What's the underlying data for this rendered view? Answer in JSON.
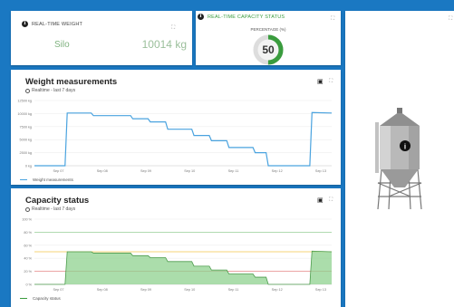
{
  "weight_card": {
    "title": "REAL-TIME WEIGHT",
    "location": "Silo",
    "value": "10014 kg"
  },
  "capacity_card": {
    "title": "REAL-TIME CAPACITY STATUS",
    "subtitle": "PERCENTAGE (%)",
    "value": "50",
    "percent": 50,
    "accent": "#3a9c3e"
  },
  "weight_chart": {
    "title": "Weight measurements",
    "subtitle": "Realtime - last 7 days",
    "legend": "Weight measurements",
    "line_color": "#4aa3df"
  },
  "capacity_chart": {
    "title": "Capacity status",
    "subtitle": "Realtime - last 7 days",
    "legend": "Capacity status",
    "fill_color": "#8fd18f"
  },
  "chart_data": [
    {
      "type": "line",
      "x": [
        "Sep 07",
        "Sep 08",
        "Sep 09",
        "Sep 10",
        "Sep 11",
        "Sep 12",
        "Sep 13"
      ],
      "y_ticks": [
        "0 kg",
        "2500 kg",
        "5000 kg",
        "7500 kg",
        "10000 kg",
        "12500 kg"
      ],
      "ylim": [
        0,
        12500
      ],
      "series": [
        {
          "name": "Weight measurements",
          "points": [
            [
              0.0,
              0
            ],
            [
              0.7,
              0
            ],
            [
              0.75,
              10100
            ],
            [
              1.3,
              10100
            ],
            [
              1.35,
              9600
            ],
            [
              2.2,
              9600
            ],
            [
              2.25,
              9000
            ],
            [
              2.6,
              9000
            ],
            [
              2.65,
              8400
            ],
            [
              3.0,
              8400
            ],
            [
              3.05,
              7000
            ],
            [
              3.6,
              7000
            ],
            [
              3.65,
              5800
            ],
            [
              4.0,
              5800
            ],
            [
              4.05,
              4800
            ],
            [
              4.4,
              4800
            ],
            [
              4.45,
              3500
            ],
            [
              5.0,
              3500
            ],
            [
              5.05,
              2500
            ],
            [
              5.3,
              2500
            ],
            [
              5.35,
              0
            ],
            [
              6.3,
              0
            ],
            [
              6.35,
              10200
            ],
            [
              6.8,
              10100
            ]
          ]
        }
      ]
    },
    {
      "type": "area",
      "x": [
        "Sep 07",
        "Sep 08",
        "Sep 09",
        "Sep 10",
        "Sep 11",
        "Sep 12",
        "Sep 13"
      ],
      "y_ticks": [
        "0 %",
        "20 %",
        "40 %",
        "60 %",
        "80 %",
        "100 %"
      ],
      "ylim": [
        0,
        100
      ],
      "thresholds": [
        {
          "value": 80,
          "color": "#9ad09a"
        },
        {
          "value": 50,
          "color": "#f0c64a"
        },
        {
          "value": 20,
          "color": "#e88a8a"
        }
      ],
      "series": [
        {
          "name": "Capacity status",
          "points": [
            [
              0.0,
              0
            ],
            [
              0.7,
              0
            ],
            [
              0.75,
              50
            ],
            [
              1.3,
              50
            ],
            [
              1.35,
              48
            ],
            [
              2.2,
              48
            ],
            [
              2.25,
              44
            ],
            [
              2.6,
              44
            ],
            [
              2.65,
              41
            ],
            [
              3.0,
              41
            ],
            [
              3.05,
              35
            ],
            [
              3.6,
              35
            ],
            [
              3.65,
              28
            ],
            [
              4.0,
              28
            ],
            [
              4.05,
              22
            ],
            [
              4.4,
              22
            ],
            [
              4.45,
              16
            ],
            [
              5.0,
              16
            ],
            [
              5.05,
              11
            ],
            [
              5.3,
              11
            ],
            [
              5.35,
              0
            ],
            [
              6.3,
              0
            ],
            [
              6.35,
              51
            ],
            [
              6.8,
              50
            ]
          ]
        }
      ]
    }
  ]
}
